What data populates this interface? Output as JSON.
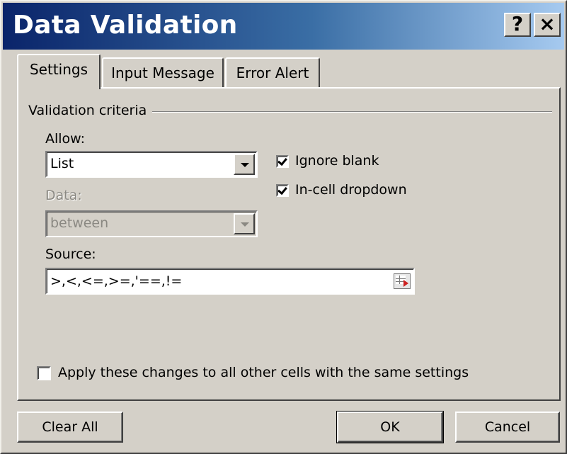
{
  "window": {
    "title": "Data Validation",
    "help_label": "?",
    "close_label": "×"
  },
  "tabs": [
    {
      "label": "Settings",
      "active": true
    },
    {
      "label": "Input Message",
      "active": false
    },
    {
      "label": "Error Alert",
      "active": false
    }
  ],
  "settings": {
    "group_label": "Validation criteria",
    "allow": {
      "label": "Allow:",
      "value": "List"
    },
    "data": {
      "label": "Data:",
      "value": "between",
      "disabled": true
    },
    "ignore_blank": {
      "label": "Ignore blank",
      "checked": true
    },
    "in_cell_dropdown": {
      "label": "In-cell dropdown",
      "checked": true
    },
    "source": {
      "label": "Source:",
      "value": ">,<,<=,>=,'==,!="
    },
    "apply_all": {
      "label": "Apply these changes to all other cells with the same settings",
      "checked": false
    }
  },
  "buttons": {
    "clear_all": "Clear All",
    "ok": "OK",
    "cancel": "Cancel"
  }
}
